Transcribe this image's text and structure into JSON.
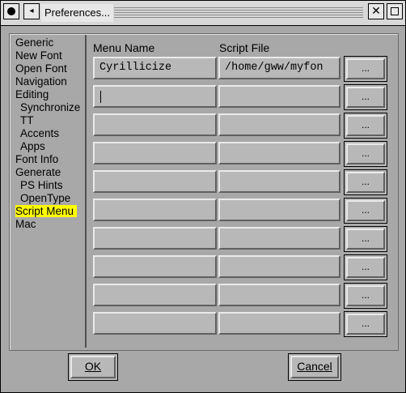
{
  "window": {
    "title": "Preferences..."
  },
  "sidebar": {
    "items": [
      {
        "label": "Generic",
        "sub": false,
        "selected": false
      },
      {
        "label": "New Font",
        "sub": false,
        "selected": false
      },
      {
        "label": "Open Font",
        "sub": false,
        "selected": false
      },
      {
        "label": "Navigation",
        "sub": false,
        "selected": false
      },
      {
        "label": "Editing",
        "sub": false,
        "selected": false
      },
      {
        "label": "Synchronize",
        "sub": true,
        "selected": false
      },
      {
        "label": "TT",
        "sub": true,
        "selected": false
      },
      {
        "label": "Accents",
        "sub": true,
        "selected": false
      },
      {
        "label": "Apps",
        "sub": true,
        "selected": false
      },
      {
        "label": "Font Info",
        "sub": false,
        "selected": false
      },
      {
        "label": "Generate",
        "sub": false,
        "selected": false
      },
      {
        "label": "PS Hints",
        "sub": true,
        "selected": false
      },
      {
        "label": "OpenType",
        "sub": true,
        "selected": false
      },
      {
        "label": "Script Menu",
        "sub": false,
        "selected": true
      },
      {
        "label": "Mac",
        "sub": false,
        "selected": false
      }
    ]
  },
  "script_menu": {
    "col_menu_name": "Menu Name",
    "col_script_file": "Script File",
    "browse_label": "...",
    "rows": [
      {
        "menu_name": "Cyrillicize",
        "script_file": "/home/gww/myfon"
      },
      {
        "menu_name": "",
        "script_file": ""
      },
      {
        "menu_name": "",
        "script_file": ""
      },
      {
        "menu_name": "",
        "script_file": ""
      },
      {
        "menu_name": "",
        "script_file": ""
      },
      {
        "menu_name": "",
        "script_file": ""
      },
      {
        "menu_name": "",
        "script_file": ""
      },
      {
        "menu_name": "",
        "script_file": ""
      },
      {
        "menu_name": "",
        "script_file": ""
      },
      {
        "menu_name": "",
        "script_file": ""
      }
    ]
  },
  "buttons": {
    "ok": "OK",
    "cancel": "Cancel"
  },
  "colors": {
    "selection": "#ffff00",
    "dialog_bg": "#a8a8a8"
  }
}
